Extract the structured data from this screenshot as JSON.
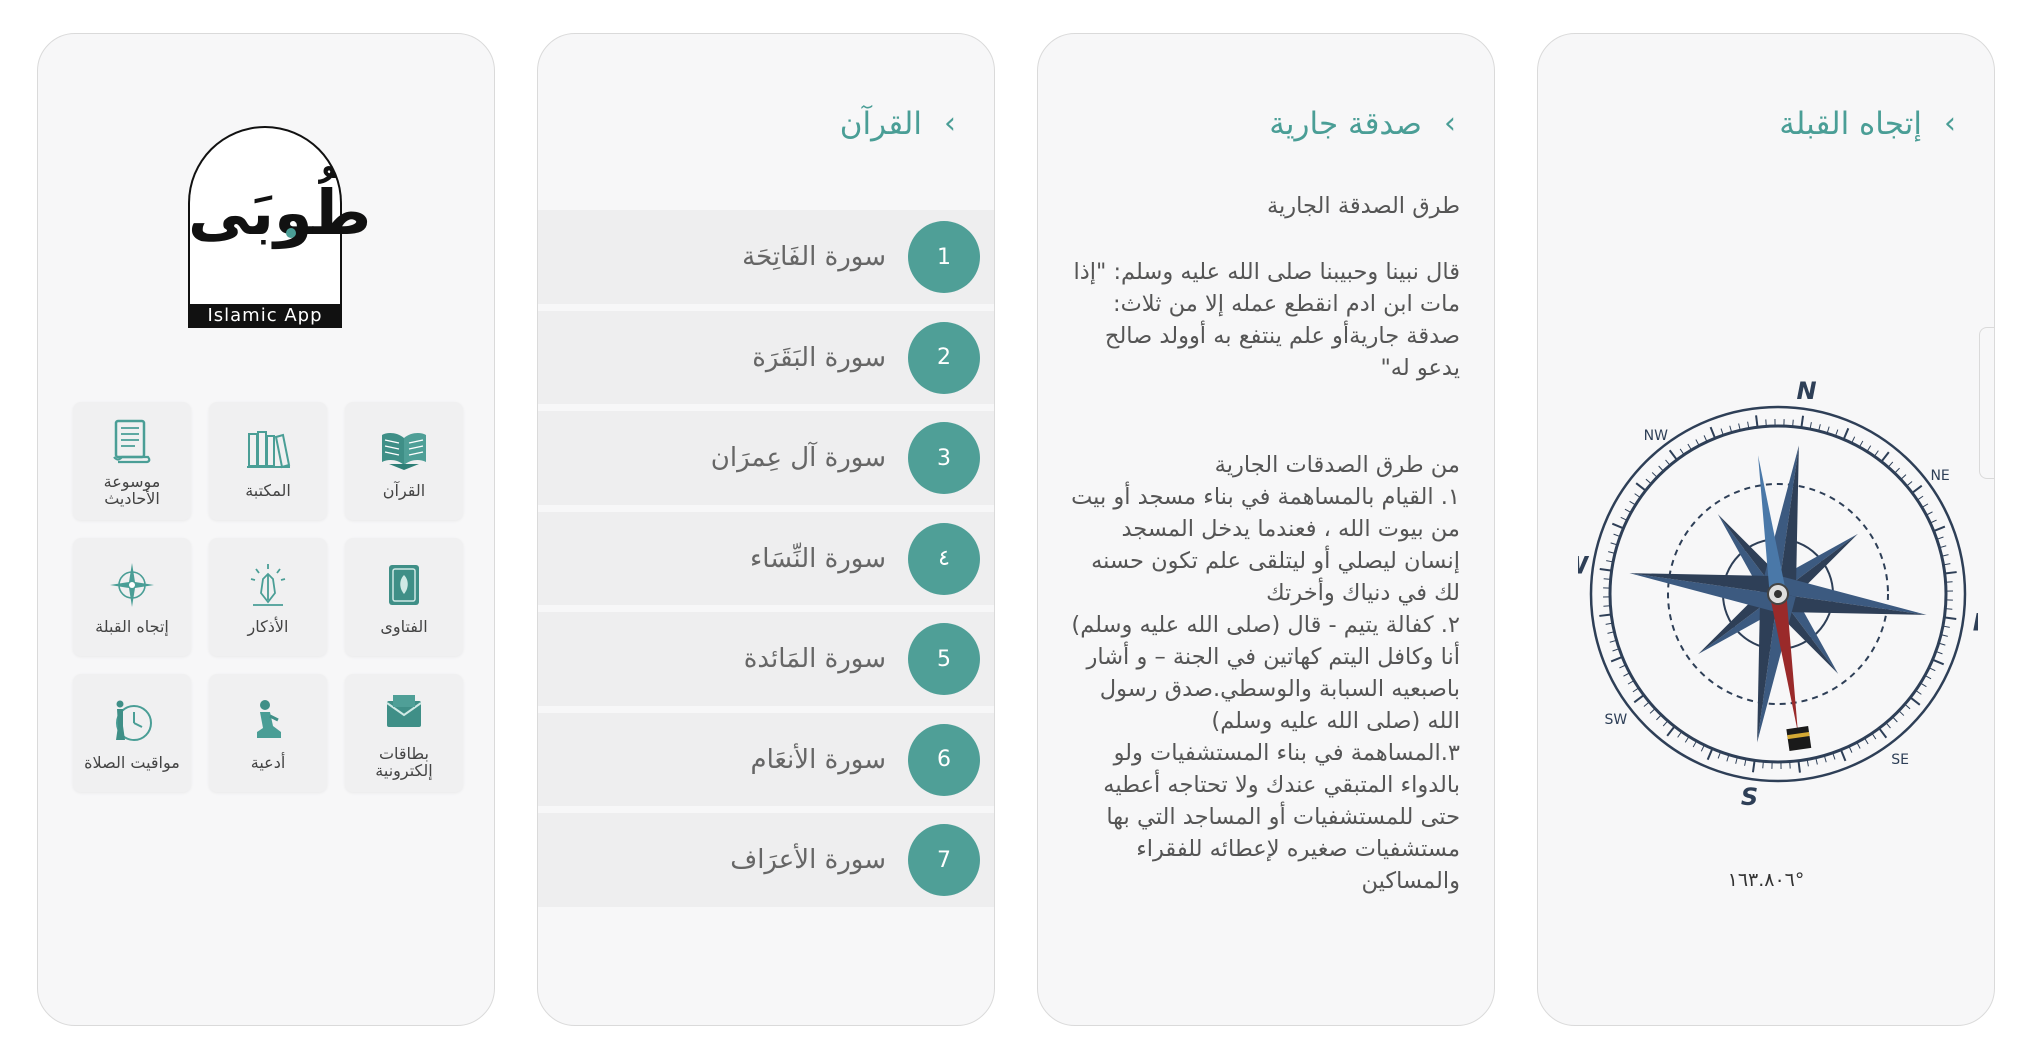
{
  "home": {
    "logo_script": "طُوبَى",
    "logo_band": "Islamic App",
    "tiles": [
      {
        "label": "القرآن",
        "icon": "open-book-icon"
      },
      {
        "label": "المكتبة",
        "icon": "bookshelf-icon"
      },
      {
        "label": "موسوعة الأحاديث",
        "icon": "scroll-icon"
      },
      {
        "label": "الفتاوى",
        "icon": "quran-cover-icon"
      },
      {
        "label": "الأذكار",
        "icon": "praying-hands-icon"
      },
      {
        "label": "إتجاه القبلة",
        "icon": "compass-icon"
      },
      {
        "label": "بطاقات إلكترونية",
        "icon": "envelope-icon"
      },
      {
        "label": "أدعية",
        "icon": "kneeling-person-icon"
      },
      {
        "label": "مواقيت الصلاة",
        "icon": "clock-person-icon"
      }
    ]
  },
  "quran": {
    "title": "القرآن",
    "back": "‹",
    "surahs": [
      {
        "num": "1",
        "name": "سورة الفَاتِحَة"
      },
      {
        "num": "2",
        "name": "سورة البَقَرَة"
      },
      {
        "num": "3",
        "name": "سورة آل عِمرَان"
      },
      {
        "num": "٤",
        "name": "سورة النِّسَاء"
      },
      {
        "num": "5",
        "name": "سورة المَائدة"
      },
      {
        "num": "6",
        "name": "سورة الأنعَام"
      },
      {
        "num": "7",
        "name": "سورة الأعرَاف"
      }
    ]
  },
  "sadaqa": {
    "title": "صدقة جارية",
    "back": "‹",
    "subtitle": "طرق الصدقة الجارية",
    "hadith": "قال نبينا وحبيبنا صلى الله عليه وسلم: \"إذا مات ابن ادم انقطع عمله إلا من ثلاث: صدقة جاريةأو علم ينتفع به أوولد صالح يدعو له\"",
    "list_heading": "من طرق الصدقات الجارية",
    "list": [
      "١. القيام بالمساهمة في بناء مسجد أو بيت من بيوت الله ، فعندما يدخل المسجد إنسان ليصلي أو ليتلقى علم تكون حسنه لك في دنياك وأخرتك",
      "٢. كفالة يتيم - قال (صلى الله عليه وسلم) أنا وكافل اليتم كهاتين في الجنة – و أشار باصبعيه السبابة والوسطي.صدق رسول الله (صلى الله عليه وسلم)",
      "٣.المساهمة في بناء المستشفيات ولو بالدواء المتبقي عندك ولا تحتاجه أعطيه حتى للمستشفيات أو المساجد التي بها مستشفيات صغيره لإعطائه للفقراء والمساكين"
    ]
  },
  "qibla": {
    "title": "إتجاه القبلة",
    "back": "‹",
    "cardinals": {
      "n": "N",
      "e": "E",
      "s": "S",
      "w": "W"
    },
    "intercardinals": {
      "ne": "NE",
      "se": "SE",
      "sw": "SW",
      "nw": "NW"
    },
    "bearing": "١٦٣.٨٠٦°",
    "needle_angle_deg": 163.806,
    "colors": {
      "accent": "#4a9e96",
      "rose_dark": "#2e3f57",
      "rose_light": "#3c5a80",
      "needle_red": "#9a2a2a"
    }
  }
}
